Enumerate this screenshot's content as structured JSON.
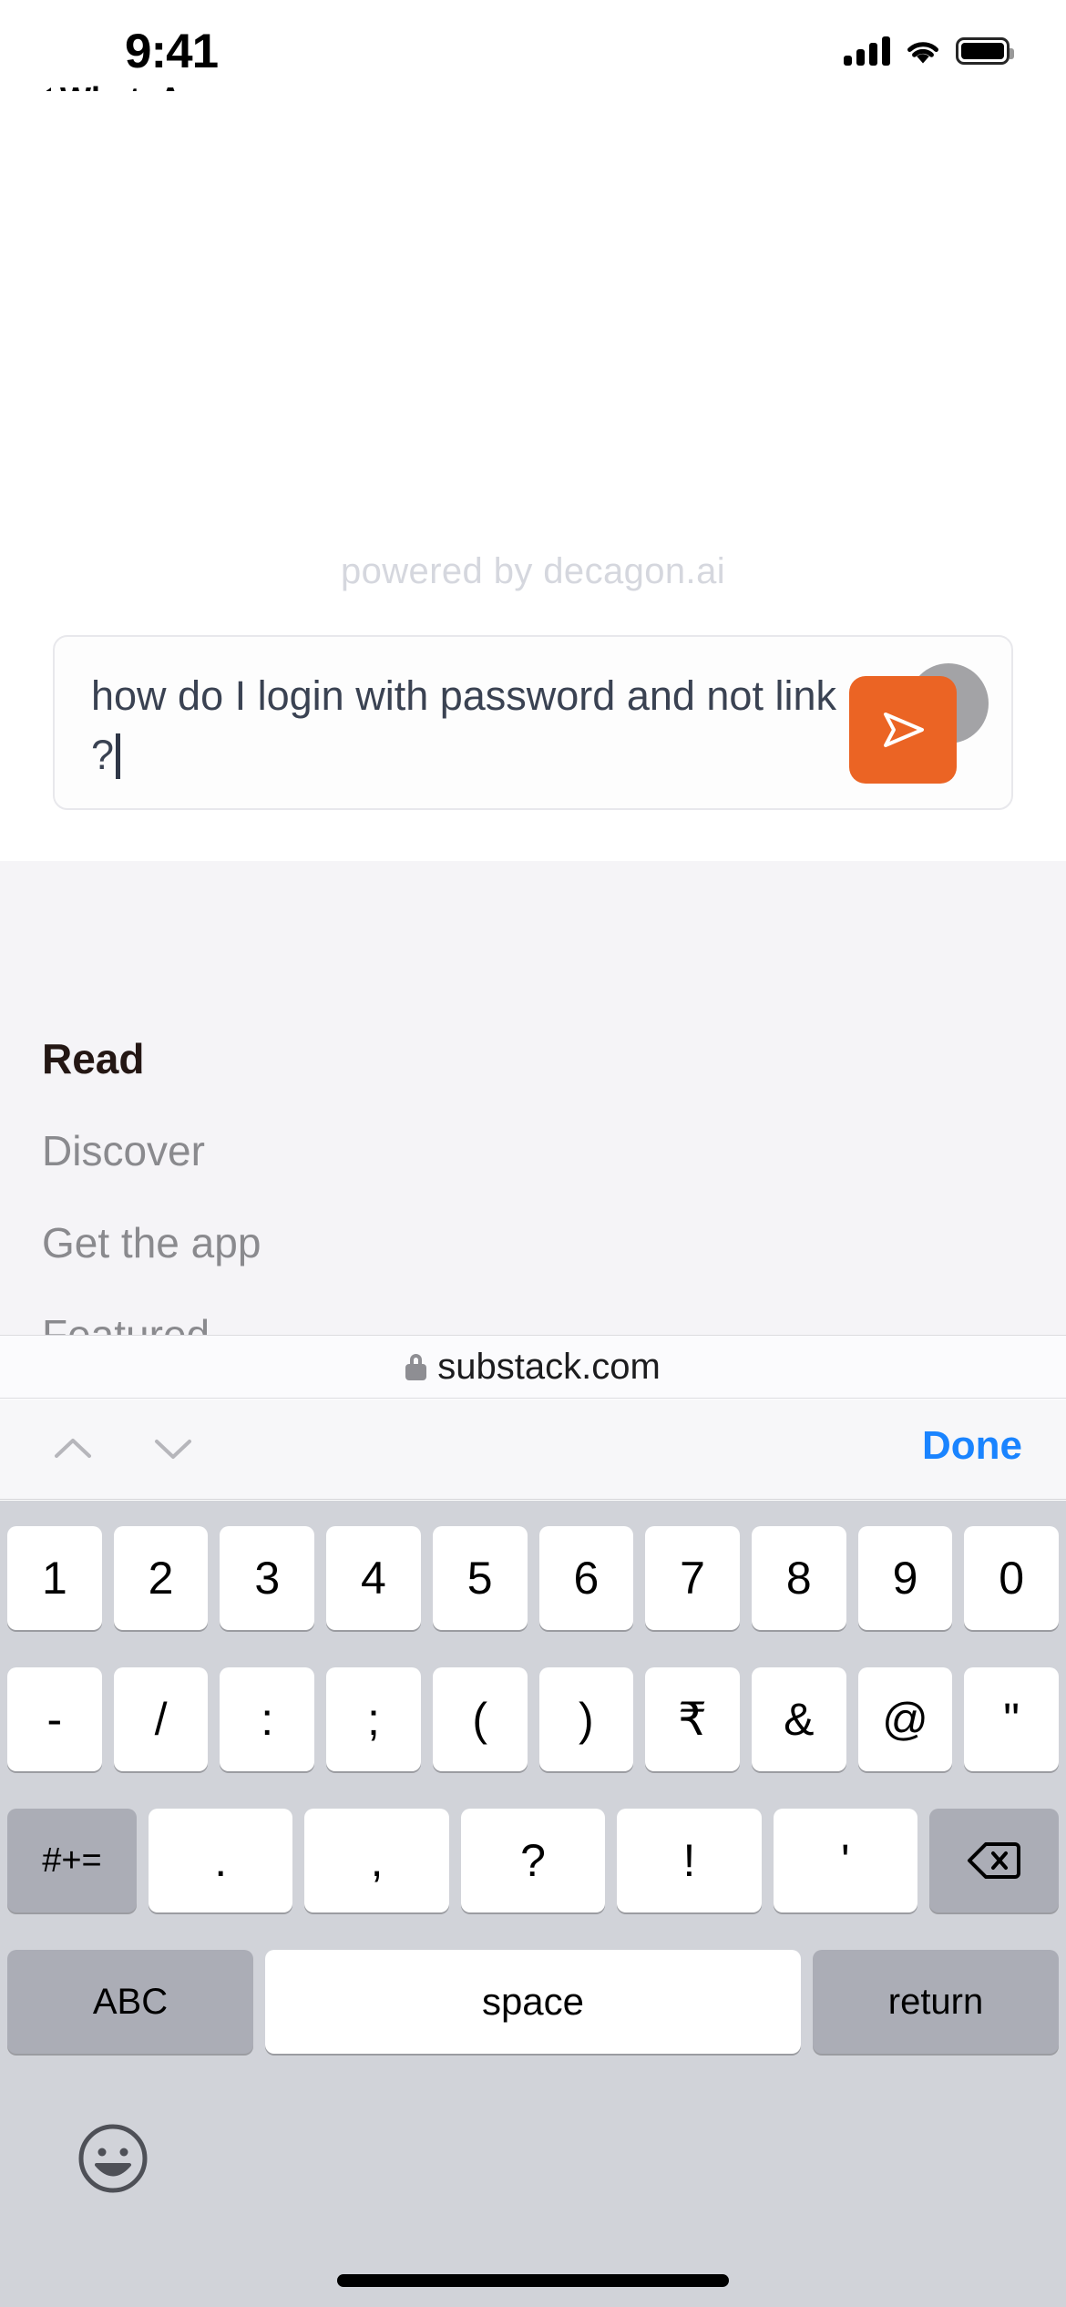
{
  "status_bar": {
    "time": "9:41",
    "icons": [
      "cellular-signal-icon",
      "wifi-icon",
      "battery-icon"
    ],
    "signal_bars": 4,
    "battery_full": true
  },
  "back_link": {
    "label": "WhatsApp",
    "icon": "back-caret-icon"
  },
  "page": {
    "powered_by": "powered by decagon.ai",
    "composer": {
      "value": "how do I login with password and not link ?",
      "line1": "how do I login with password and",
      "line2": "not link ?",
      "has_caret": true,
      "send_button_label": "send-icon",
      "send_button_color": "#EB6424",
      "text_color": "#3A4252"
    },
    "nav": {
      "items": [
        {
          "label": "Read",
          "active": true
        },
        {
          "label": "Discover",
          "active": false
        },
        {
          "label": "Get the app",
          "active": false
        },
        {
          "label": "Featured",
          "active": false
        }
      ]
    }
  },
  "url_bar": {
    "lock_icon": "lock-icon",
    "domain": "substack.com",
    "secure": true
  },
  "accessory_bar": {
    "prev_icon": "chevron-up-icon",
    "next_icon": "chevron-down-icon",
    "done_label": "Done",
    "done_color": "#1A84FF",
    "prev_enabled": false,
    "next_enabled": false
  },
  "keyboard": {
    "layout": "numbers-symbols",
    "background": "#D1D3D9",
    "row1": [
      "1",
      "2",
      "3",
      "4",
      "5",
      "6",
      "7",
      "8",
      "9",
      "0"
    ],
    "row2": [
      "-",
      "/",
      ":",
      ";",
      "(",
      ")",
      "₹",
      "&",
      "@",
      "\""
    ],
    "row3": {
      "symbols_label": "#+=",
      "keys": [
        ".",
        ",",
        "?",
        "!",
        "'"
      ],
      "backspace_icon": "backspace-icon"
    },
    "row4": {
      "abc_label": "ABC",
      "space_label": "space",
      "return_label": "return"
    },
    "emoji_key_icon": "emoji-smiley-icon"
  },
  "home_indicator": "home-indicator"
}
